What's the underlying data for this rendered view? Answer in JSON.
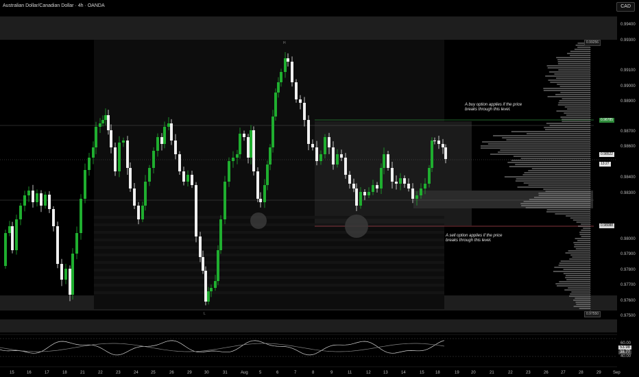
{
  "header": {
    "title": "Australian Dollar/Canadian Dollar · 4h · OANDA",
    "currency": "CAD"
  },
  "price_axis": {
    "labels": [
      "0.99400",
      "0.99300",
      "0.99100",
      "0.99000",
      "0.98900",
      "0.98700",
      "0.98600",
      "0.98400",
      "0.98300",
      "0.98000",
      "0.97900",
      "0.97800",
      "0.97700",
      "0.97600",
      "0.97500"
    ],
    "resistance_tag": "0.98785",
    "current_tag": "0.98522",
    "countdown_tag": "13:27",
    "support_tag": "0.98088",
    "high_tag": "0.99256",
    "low_tag": "0.97550"
  },
  "time_axis": {
    "labels": [
      "15",
      "16",
      "17",
      "18",
      "21",
      "22",
      "23",
      "24",
      "25",
      "26",
      "29",
      "30",
      "31",
      "Aug",
      "5",
      "6",
      "7",
      "8",
      "9",
      "11",
      "12",
      "13",
      "14",
      "15",
      "18",
      "19",
      "20",
      "21",
      "22",
      "23",
      "26",
      "27",
      "28",
      "29",
      "Sep"
    ]
  },
  "annotations": {
    "buy_note": "A buy option applies if the price\nbreaks through this level.",
    "sell_note": "A sell option applies if the price\nbreaks through this level.",
    "peak_marker": "H",
    "trough_marker": "L"
  },
  "oscillator": {
    "level_upper": "60.00",
    "value_a": "53.98",
    "value_b": "38.77",
    "level_lower": "40.00"
  },
  "colors": {
    "background": "#000000",
    "bull": "#1fae2f",
    "bear": "#f0f0f0",
    "resistance_line": "#2e8b3a",
    "support_line": "#b0444f",
    "volume_profile": "#8f8f8f"
  }
}
